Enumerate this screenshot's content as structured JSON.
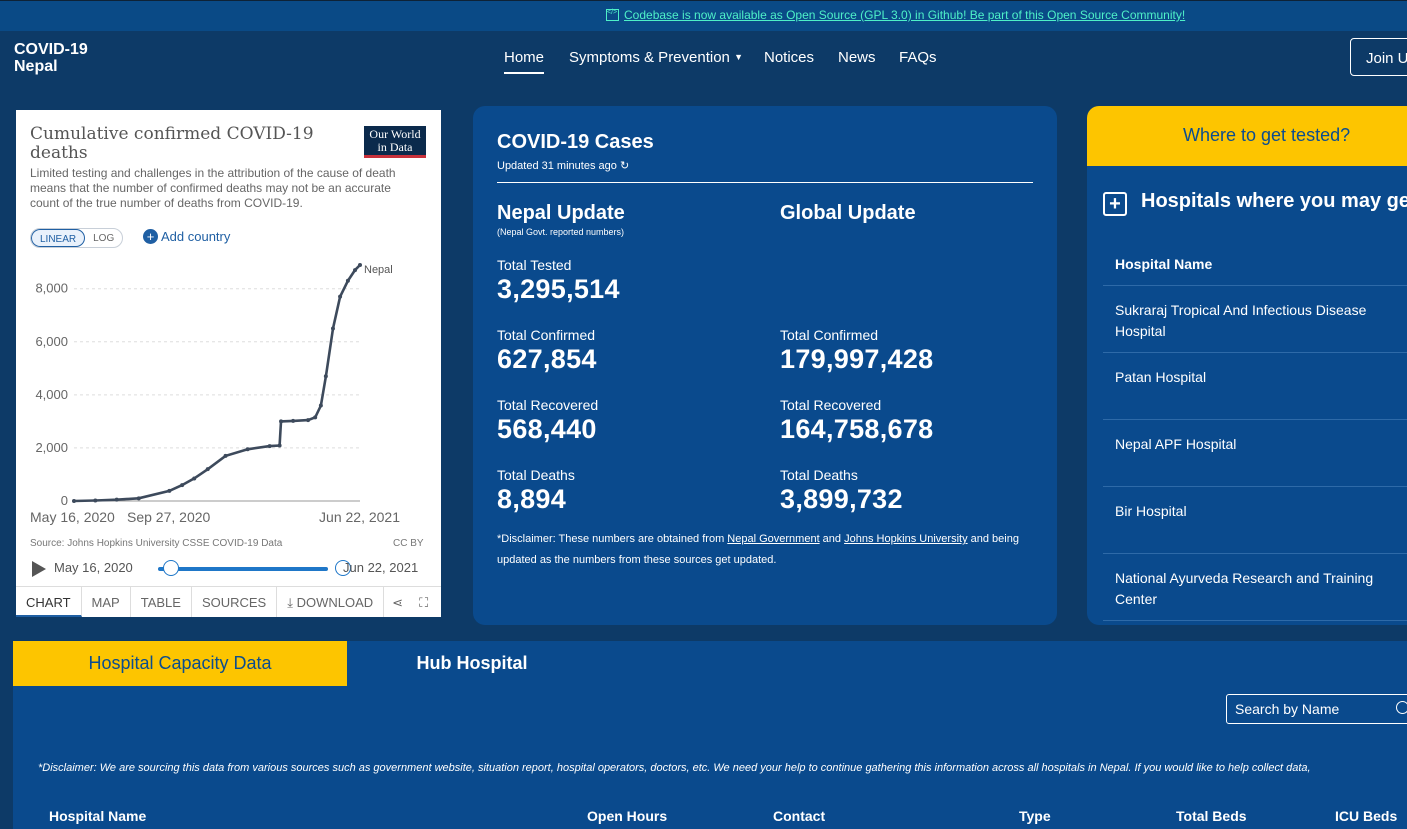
{
  "announcement": {
    "text": "Codebase is now available as Open Source (GPL 3.0) in Github! Be part of this Open Source Community!",
    "icon": "code-icon"
  },
  "brand": {
    "line1": "COVID-19",
    "line2": "Nepal"
  },
  "nav": {
    "home": "Home",
    "symptoms": "Symptoms & Prevention",
    "notices": "Notices",
    "news": "News",
    "faqs": "FAQs",
    "join": "Join Us"
  },
  "owid": {
    "title": "Cumulative confirmed COVID-19 deaths",
    "logo_line1": "Our World",
    "logo_line2": "in Data",
    "subtitle": "Limited testing and challenges in the attribution of the cause of death means that the number of confirmed deaths may not be an accurate count of the true number of deaths from COVID-19.",
    "linear": "LINEAR",
    "log": "LOG",
    "add_country": "Add country",
    "source": "Source: Johns Hopkins University CSSE COVID-19 Data",
    "license": "CC BY",
    "timeline_start": "May 16, 2020",
    "timeline_end": "Jun 22, 2021",
    "tabs": {
      "chart": "CHART",
      "map": "MAP",
      "table": "TABLE",
      "sources": "SOURCES",
      "download": "DOWNLOAD"
    }
  },
  "chart_data": {
    "type": "line",
    "title": "Cumulative confirmed COVID-19 deaths",
    "series": [
      {
        "name": "Nepal",
        "x": [
          "2020-05-16",
          "2020-06-15",
          "2020-07-15",
          "2020-08-15",
          "2020-09-27",
          "2020-10-15",
          "2020-11-01",
          "2020-11-20",
          "2020-12-15",
          "2021-01-15",
          "2021-02-15",
          "2021-03-01",
          "2021-03-03",
          "2021-03-20",
          "2021-04-10",
          "2021-04-20",
          "2021-04-28",
          "2021-05-05",
          "2021-05-15",
          "2021-05-25",
          "2021-06-05",
          "2021-06-15",
          "2021-06-22"
        ],
        "values": [
          0,
          20,
          50,
          100,
          380,
          600,
          850,
          1200,
          1700,
          1950,
          2070,
          2090,
          3000,
          3020,
          3050,
          3150,
          3600,
          4700,
          6500,
          7700,
          8300,
          8700,
          8894
        ]
      }
    ],
    "x_ticks": [
      "May 16, 2020",
      "Sep 27, 2020",
      "Jun 22, 2021"
    ],
    "y_ticks": [
      0,
      2000,
      4000,
      6000,
      8000
    ],
    "y_tick_labels": [
      "0",
      "2,000",
      "4,000",
      "6,000",
      "8,000"
    ],
    "ylim": [
      0,
      8894
    ],
    "xlim": [
      "2020-05-16",
      "2021-06-22"
    ],
    "grid": "horizontal"
  },
  "cases": {
    "title": "COVID-19 Cases",
    "updated": "Updated 31 minutes ago",
    "nepal_heading": "Nepal Update",
    "nepal_note": "(Nepal Govt. reported numbers)",
    "global_heading": "Global Update",
    "tested_label": "Total Tested",
    "tested_value": "3,295,514",
    "confirmed_label": "Total Confirmed",
    "nepal_confirmed": "627,854",
    "global_confirmed": "179,997,428",
    "recovered_label": "Total Recovered",
    "nepal_recovered": "568,440",
    "global_recovered": "164,758,678",
    "deaths_label": "Total Deaths",
    "nepal_deaths": "8,894",
    "global_deaths": "3,899,732",
    "disc_pre": "*Disclaimer: These numbers are obtained from ",
    "disc_link1": "Nepal Government",
    "disc_mid": " and ",
    "disc_link2": "Johns Hopkins University",
    "disc_post": " and being updated as the numbers from these sources get updated."
  },
  "tested": {
    "header": "Where to get tested?",
    "title": "Hospitals where you may get tested",
    "column": "Hospital Name",
    "hospitals": [
      "Sukraraj Tropical And Infectious Disease Hospital",
      "Patan Hospital",
      "Nepal APF Hospital",
      "Bir Hospital",
      "National Ayurveda Research and Training Center"
    ]
  },
  "bottom": {
    "tab1": "Hospital Capacity Data",
    "tab2": "Hub Hospital",
    "search_placeholder": "Search by Name",
    "disclaimer": "*Disclaimer: We are sourcing this data from various sources such as government website, situation report, hospital operators, doctors, etc. We need your help to continue gathering this information across all hospitals in Nepal. If you would like to help collect data,",
    "columns": [
      "Hospital Name",
      "Open Hours",
      "Contact",
      "Type",
      "Total Beds",
      "ICU Beds"
    ]
  },
  "colors": {
    "page_bg": "#0d3a67",
    "card_bg": "#0a4a8d",
    "accent": "#fdc500",
    "link": "#4ef0c8"
  }
}
